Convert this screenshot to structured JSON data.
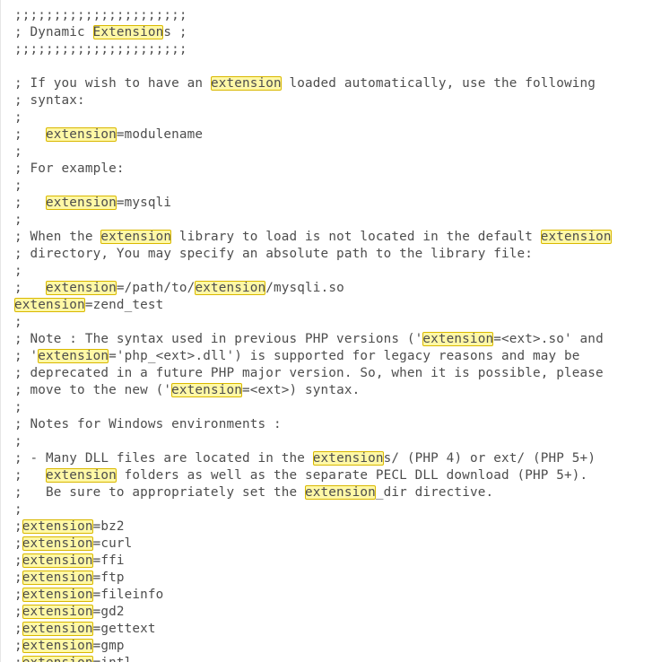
{
  "search": {
    "term": "extension"
  },
  "colors": {
    "text": "#4d4d4d",
    "highlight_bg": "#fff8a6",
    "highlight_border": "#d9b800"
  },
  "lines": [
    ";;;;;;;;;;;;;;;;;;;;;;",
    "; Dynamic Extensions ;",
    ";;;;;;;;;;;;;;;;;;;;;;",
    "",
    "; If you wish to have an extension loaded automatically, use the following",
    "; syntax:",
    ";",
    ";   extension=modulename",
    ";",
    "; For example:",
    ";",
    ";   extension=mysqli",
    ";",
    "; When the extension library to load is not located in the default extension",
    "; directory, You may specify an absolute path to the library file:",
    ";",
    ";   extension=/path/to/extension/mysqli.so",
    "extension=zend_test",
    ";",
    "; Note : The syntax used in previous PHP versions ('extension=<ext>.so' and",
    "; 'extension='php_<ext>.dll') is supported for legacy reasons and may be",
    "; deprecated in a future PHP major version. So, when it is possible, please",
    "; move to the new ('extension=<ext>) syntax.",
    ";",
    "; Notes for Windows environments :",
    ";",
    "; - Many DLL files are located in the extensions/ (PHP 4) or ext/ (PHP 5+)",
    ";   extension folders as well as the separate PECL DLL download (PHP 5+).",
    ";   Be sure to appropriately set the extension_dir directive.",
    ";",
    ";extension=bz2",
    ";extension=curl",
    ";extension=ffi",
    ";extension=ftp",
    ";extension=fileinfo",
    ";extension=gd2",
    ";extension=gettext",
    ";extension=gmp",
    ";extension=intl"
  ]
}
